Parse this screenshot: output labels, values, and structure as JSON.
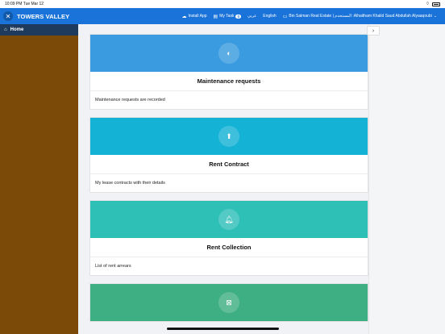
{
  "status_bar": {
    "time": "10:09 PM  Tue Mar 12"
  },
  "header": {
    "brand": "TOWERS VALLEY",
    "install_app": "Install App",
    "my_task": "My Task",
    "my_task_count": "0",
    "lang_arabic": "عربي",
    "lang_english": "English",
    "user_info": "Bin Salman Real Estate | المستخدم :Alhaitham Khalid Saud Abdullah Alyaaqoubi"
  },
  "sidebar": {
    "home_label": "Home"
  },
  "cards": [
    {
      "title": "Maintenance requests",
      "description": "Maintenance requests are recorded",
      "color": "#3a9be0",
      "icon": "clock-icon"
    },
    {
      "title": "Rent Contract",
      "description": "My lease contracts with their details",
      "color": "#14b3d6",
      "icon": "upload-icon"
    },
    {
      "title": "Rent Collection",
      "description": "List of rent arrears",
      "color": "#2ebfb7",
      "icon": "bell-icon"
    },
    {
      "title": "",
      "description": "",
      "color": "#3daf82",
      "icon": "grid-icon"
    }
  ],
  "colors": {
    "topbar": "#1a73d9",
    "sidebar": "#7c4a08",
    "home_active": "#1e3a5c"
  }
}
